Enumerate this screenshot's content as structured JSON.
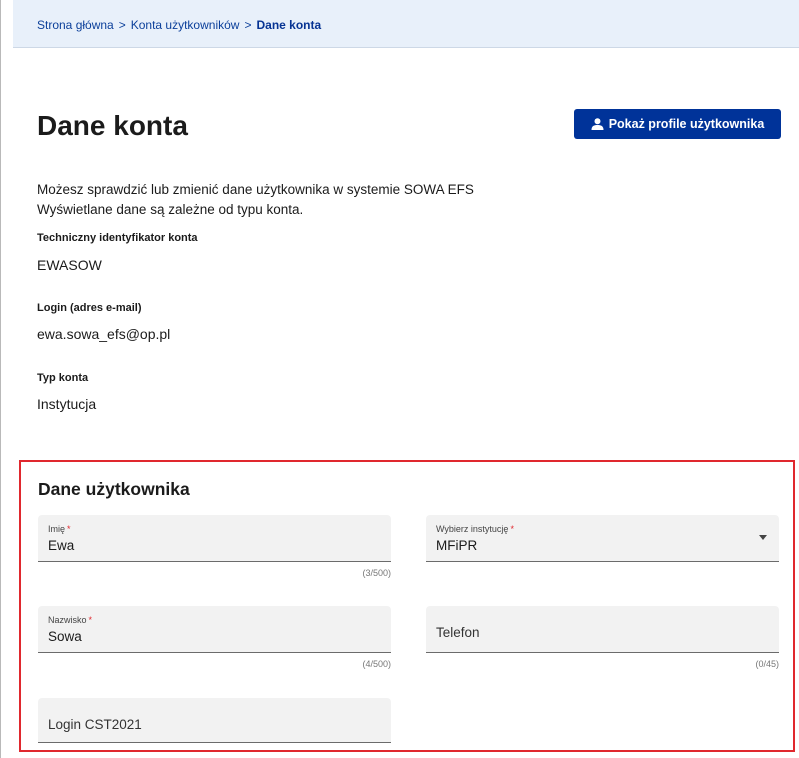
{
  "breadcrumb": {
    "items": [
      "Strona główna",
      "Konta użytkowników",
      "Dane konta"
    ],
    "separator": ">"
  },
  "header": {
    "title": "Dane konta",
    "profile_button_label": "Pokaż profile użytkownika",
    "profile_button_icon": "person-icon"
  },
  "intro": {
    "line1": "Możesz sprawdzić lub zmienić dane użytkownika w systemie SOWA EFS",
    "line2": "Wyświetlane dane są zależne od typu konta."
  },
  "account_info": [
    {
      "label": "Techniczny identyfikator konta",
      "value": "EWASOW"
    },
    {
      "label": "Login (adres e-mail)",
      "value": "ewa.sowa_efs@op.pl"
    },
    {
      "label": "Typ konta",
      "value": "Instytucja"
    }
  ],
  "user_form": {
    "title": "Dane użytkownika",
    "required_marker": "*",
    "first_name": {
      "label": "Imię",
      "value": "Ewa",
      "counter": "(3/500)"
    },
    "institution": {
      "label": "Wybierz instytucję",
      "value": "MFiPR"
    },
    "last_name": {
      "label": "Nazwisko",
      "value": "Sowa",
      "counter": "(4/500)"
    },
    "phone": {
      "label": "Telefon",
      "counter": "(0/45)"
    },
    "login_cst": {
      "label": "Login CST2021"
    }
  },
  "colors": {
    "primary": "#003399",
    "breadcrumb_bg": "#e8f0fa",
    "highlight_border": "#e0282e",
    "field_bg": "#f2f2f2"
  }
}
